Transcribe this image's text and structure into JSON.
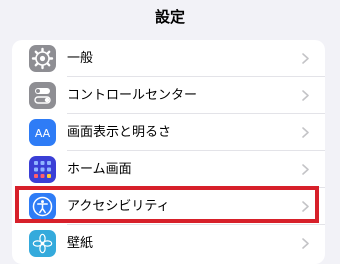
{
  "header": {
    "title": "設定"
  },
  "settings": {
    "items": [
      {
        "label": "一般",
        "icon": "gear-icon",
        "color": "#8e8e93"
      },
      {
        "label": "コントロールセンター",
        "icon": "toggles-icon",
        "color": "#8e8e93"
      },
      {
        "label": "画面表示と明るさ",
        "icon": "text-size-icon",
        "icon_text": "AA",
        "color": "#2e7cf6"
      },
      {
        "label": "ホーム画面",
        "icon": "home-screen-grid-icon",
        "color": "#3a3fd6"
      },
      {
        "label": "アクセシビリティ",
        "icon": "accessibility-icon",
        "color": "#2e7cf6"
      },
      {
        "label": "壁紙",
        "icon": "wallpaper-flower-icon",
        "color": "#34aadc"
      }
    ]
  },
  "highlight": {
    "color": "#d7202a",
    "target": "アクセシビリティ"
  }
}
